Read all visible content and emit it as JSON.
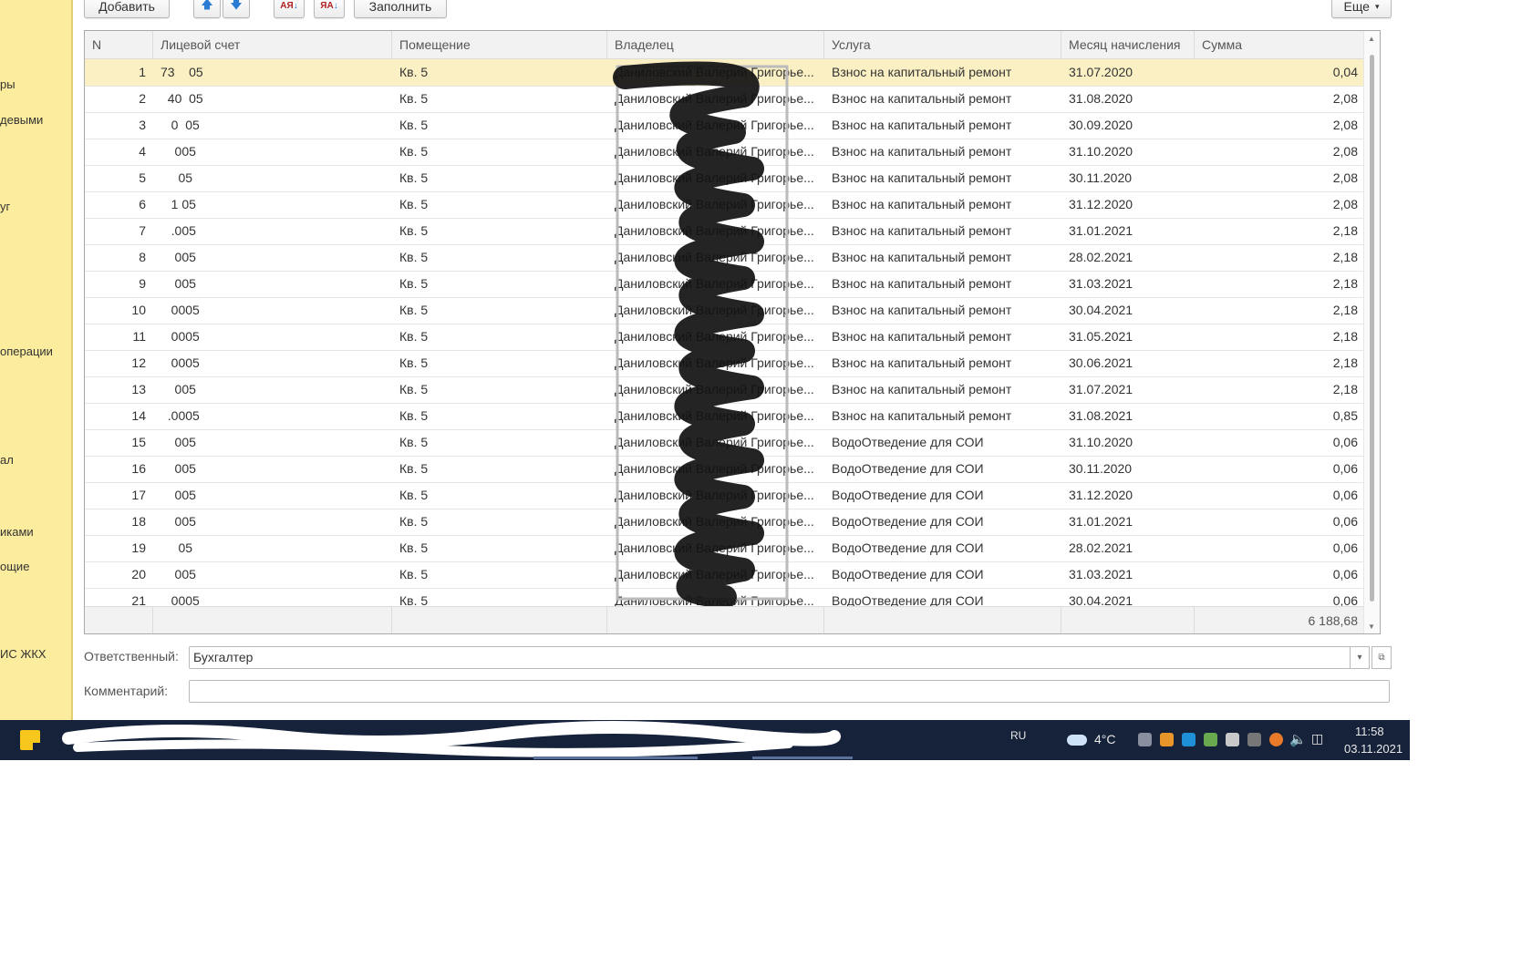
{
  "sidebar": {
    "items": [
      "ры",
      "девыми",
      "уг",
      "операции",
      "ал",
      "иками",
      "ощие",
      "ИС ЖКХ"
    ]
  },
  "toolbar": {
    "add_label": "Добавить",
    "up_icon": "arrow-up-icon",
    "down_icon": "arrow-down-icon",
    "sort_asc_label": "АЯ",
    "sort_desc_label": "ЯА",
    "fill_label": "Заполнить",
    "more_label": "Еще"
  },
  "table": {
    "columns": [
      "N",
      "Лицевой счет",
      "Помещение",
      "Владелец",
      "Услуга",
      "Месяц начисления",
      "Сумма"
    ],
    "rows": [
      {
        "n": "1",
        "account": "73    05",
        "room": "Кв. 5",
        "owner": "Даниловский Валерий Григорье...",
        "service": "Взнос на капитальный ремонт",
        "month": "31.07.2020",
        "sum": "0,04"
      },
      {
        "n": "2",
        "account": "  40  05",
        "room": "Кв. 5",
        "owner": "Даниловский Валерий Григорье...",
        "service": "Взнос на капитальный ремонт",
        "month": "31.08.2020",
        "sum": "2,08"
      },
      {
        "n": "3",
        "account": "   0  05",
        "room": "Кв. 5",
        "owner": "Даниловский Валерий Григорье...",
        "service": "Взнос на капитальный ремонт",
        "month": "30.09.2020",
        "sum": "2,08"
      },
      {
        "n": "4",
        "account": "    005",
        "room": "Кв. 5",
        "owner": "Даниловский Валерий Григорье...",
        "service": "Взнос на капитальный ремонт",
        "month": "31.10.2020",
        "sum": "2,08"
      },
      {
        "n": "5",
        "account": "     05",
        "room": "Кв. 5",
        "owner": "Даниловский Валерий Григорье...",
        "service": "Взнос на капитальный ремонт",
        "month": "30.11.2020",
        "sum": "2,08"
      },
      {
        "n": "6",
        "account": "   1 05",
        "room": "Кв. 5",
        "owner": "Даниловский Валерий Григорье...",
        "service": "Взнос на капитальный ремонт",
        "month": "31.12.2020",
        "sum": "2,08"
      },
      {
        "n": "7",
        "account": "   .005",
        "room": "Кв. 5",
        "owner": "Даниловский Валерий Григорье...",
        "service": "Взнос на капитальный ремонт",
        "month": "31.01.2021",
        "sum": "2,18"
      },
      {
        "n": "8",
        "account": "    005",
        "room": "Кв. 5",
        "owner": "Даниловский Валерий Григорье...",
        "service": "Взнос на капитальный ремонт",
        "month": "28.02.2021",
        "sum": "2,18"
      },
      {
        "n": "9",
        "account": "    005",
        "room": "Кв. 5",
        "owner": "Даниловский Валерий Григорье...",
        "service": "Взнос на капитальный ремонт",
        "month": "31.03.2021",
        "sum": "2,18"
      },
      {
        "n": "10",
        "account": "   0005",
        "room": "Кв. 5",
        "owner": "Даниловский Валерий Григорье...",
        "service": "Взнос на капитальный ремонт",
        "month": "30.04.2021",
        "sum": "2,18"
      },
      {
        "n": "11",
        "account": "   0005",
        "room": "Кв. 5",
        "owner": "Даниловский Валерий Григорье...",
        "service": "Взнос на капитальный ремонт",
        "month": "31.05.2021",
        "sum": "2,18"
      },
      {
        "n": "12",
        "account": "   0005",
        "room": "Кв. 5",
        "owner": "Даниловский Валерий Григорье...",
        "service": "Взнос на капитальный ремонт",
        "month": "30.06.2021",
        "sum": "2,18"
      },
      {
        "n": "13",
        "account": "    005",
        "room": "Кв. 5",
        "owner": "Даниловский Валерий Григорье...",
        "service": "Взнос на капитальный ремонт",
        "month": "31.07.2021",
        "sum": "2,18"
      },
      {
        "n": "14",
        "account": "  .0005",
        "room": "Кв. 5",
        "owner": "Даниловский Валерий Григорье...",
        "service": "Взнос на капитальный ремонт",
        "month": "31.08.2021",
        "sum": "0,85"
      },
      {
        "n": "15",
        "account": "    005",
        "room": "Кв. 5",
        "owner": "Даниловский Валерий Григорье...",
        "service": "ВодоОтведение для СОИ",
        "month": "31.10.2020",
        "sum": "0,06"
      },
      {
        "n": "16",
        "account": "    005",
        "room": "Кв. 5",
        "owner": "Даниловский Валерий Григорье...",
        "service": "ВодоОтведение для СОИ",
        "month": "30.11.2020",
        "sum": "0,06"
      },
      {
        "n": "17",
        "account": "    005",
        "room": "Кв. 5",
        "owner": "Даниловский Валерий Григорье...",
        "service": "ВодоОтведение для СОИ",
        "month": "31.12.2020",
        "sum": "0,06"
      },
      {
        "n": "18",
        "account": "    005",
        "room": "Кв. 5",
        "owner": "Даниловский Валерий Григорье...",
        "service": "ВодоОтведение для СОИ",
        "month": "31.01.2021",
        "sum": "0,06"
      },
      {
        "n": "19",
        "account": "     05",
        "room": "Кв. 5",
        "owner": "Даниловский Валерий Григорье...",
        "service": "ВодоОтведение для СОИ",
        "month": "28.02.2021",
        "sum": "0,06"
      },
      {
        "n": "20",
        "account": "    005",
        "room": "Кв. 5",
        "owner": "Даниловский Валерий Григорье...",
        "service": "ВодоОтведение для СОИ",
        "month": "31.03.2021",
        "sum": "0,06"
      },
      {
        "n": "21",
        "account": "   0005",
        "room": "Кв. 5",
        "owner": "Даниловский Валерий Григорье...",
        "service": "ВодоОтведение для СОИ",
        "month": "30.04.2021",
        "sum": "0,06"
      }
    ],
    "total": "6 188,68"
  },
  "form": {
    "responsible_label": "Ответственный:",
    "responsible_value": "Бухгалтер",
    "comment_label": "Комментарий:",
    "comment_value": ""
  },
  "taskbar": {
    "lang": "RU",
    "temperature": "4°C",
    "time": "11:58",
    "date": "03.11.2021"
  }
}
